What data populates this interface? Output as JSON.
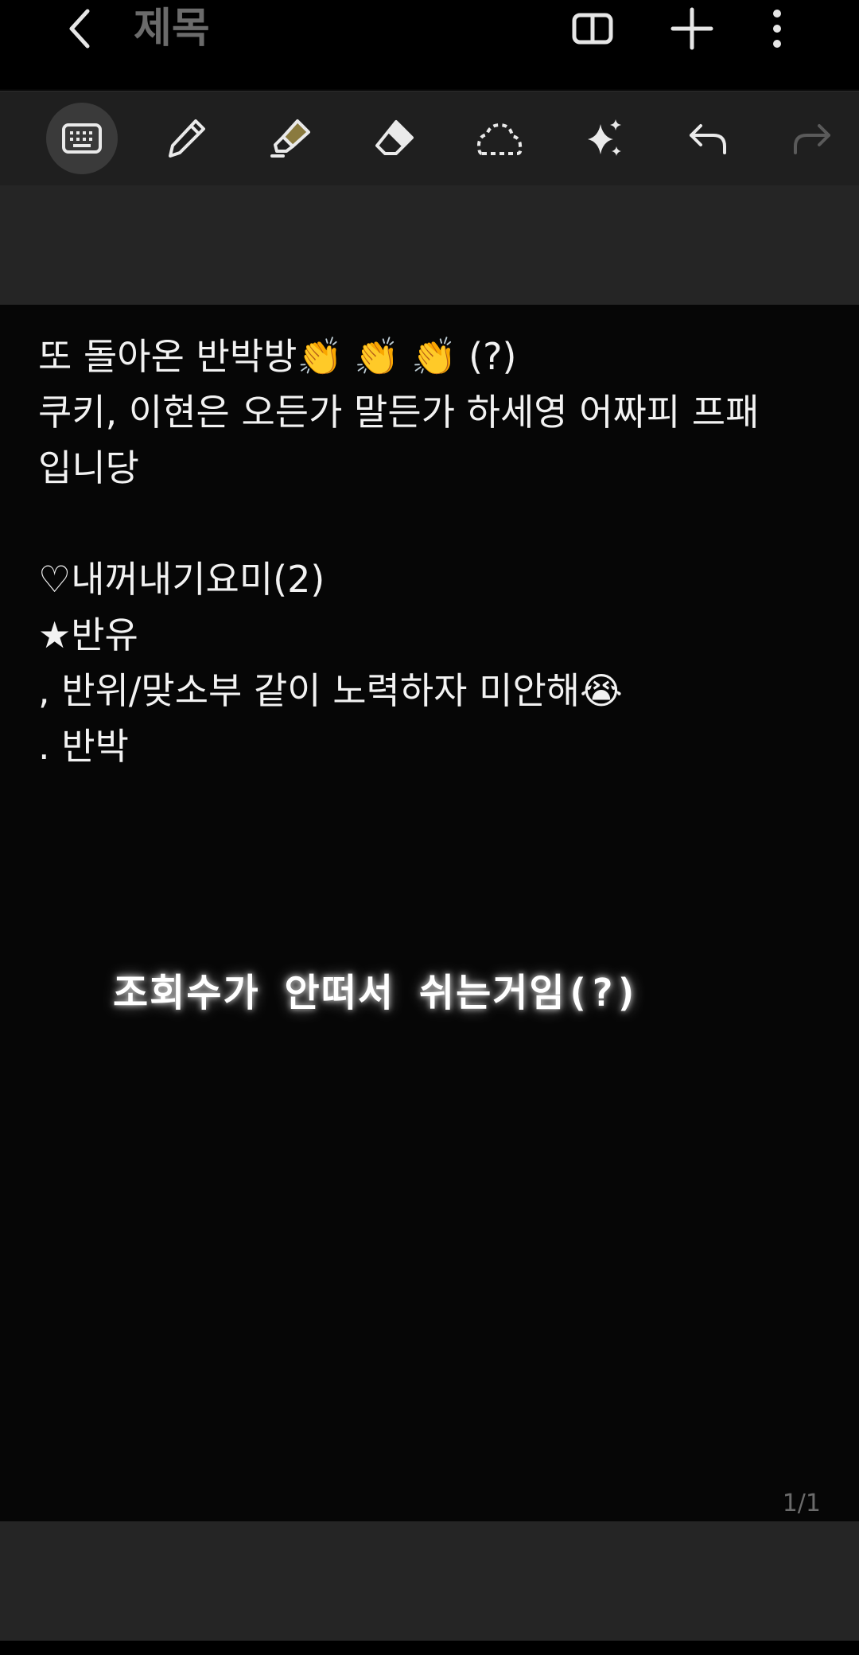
{
  "header": {
    "title": "제목",
    "back_icon": "chevron-left-icon",
    "reading_mode_icon": "book-open-icon",
    "add_icon": "plus-icon",
    "more_icon": "more-vertical-icon"
  },
  "toolbar": {
    "items": [
      {
        "icon": "keyboard-icon",
        "active": true
      },
      {
        "icon": "pen-icon"
      },
      {
        "icon": "highlighter-icon"
      },
      {
        "icon": "eraser-icon"
      },
      {
        "icon": "lasso-select-icon"
      },
      {
        "icon": "sparkles-icon"
      },
      {
        "icon": "undo-icon"
      },
      {
        "icon": "redo-icon",
        "disabled": true
      }
    ]
  },
  "note": {
    "lines": [
      "또 돌아온 반박방👏 👏 👏 (?)",
      "쿠키, 이현은 오든가 말든가 하세영 어짜피 프패",
      "입니당",
      "♡내꺼내기요미(2)",
      "★반유",
      ", 반위/맞소부 같이 노력하자 미안해😭",
      ". 반박"
    ],
    "handwritten": "조회수가 안떠서 쉬는거임(?)",
    "page_indicator": "1/1"
  }
}
